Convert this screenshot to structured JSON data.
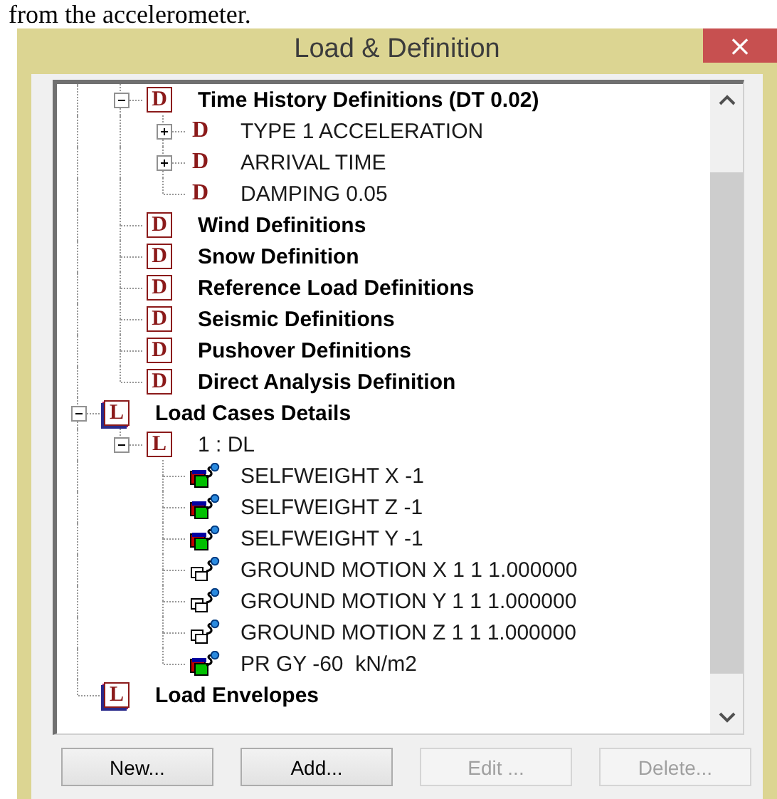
{
  "document_text": "from the accelerometer.",
  "window": {
    "title": "Load & Definition",
    "close": "×"
  },
  "tree": [
    {
      "children": [
        {
          "label": "Time History Definitions (DT 0.02)",
          "kind": "group",
          "icon": {
            "kind": "box",
            "letter": "D"
          },
          "expanded": true,
          "children": [
            {
              "label": "TYPE 1 ACCELERATION",
              "kind": "entry",
              "icon": {
                "kind": "plain",
                "letter": "D"
              },
              "expanded": false
            },
            {
              "label": "ARRIVAL TIME",
              "kind": "entry",
              "icon": {
                "kind": "plain",
                "letter": "D"
              },
              "expanded": false
            },
            {
              "label": "DAMPING 0.05",
              "kind": "entry",
              "icon": {
                "kind": "plain",
                "letter": "D"
              }
            }
          ]
        },
        {
          "label": "Wind Definitions",
          "kind": "group",
          "icon": {
            "kind": "box",
            "letter": "D"
          }
        },
        {
          "label": "Snow Definition",
          "kind": "group",
          "icon": {
            "kind": "box",
            "letter": "D"
          }
        },
        {
          "label": "Reference Load Definitions",
          "kind": "group",
          "icon": {
            "kind": "box",
            "letter": "D"
          }
        },
        {
          "label": "Seismic Definitions",
          "kind": "group",
          "icon": {
            "kind": "box",
            "letter": "D"
          }
        },
        {
          "label": "Pushover Definitions",
          "kind": "group",
          "icon": {
            "kind": "box",
            "letter": "D"
          }
        },
        {
          "label": "Direct Analysis Definition",
          "kind": "group",
          "icon": {
            "kind": "box",
            "letter": "D"
          }
        }
      ]
    },
    {
      "label": "Load Cases Details",
      "kind": "group",
      "icon": {
        "kind": "stack",
        "letter": "L"
      },
      "expanded": true,
      "children": [
        {
          "label": "1 : DL",
          "kind": "entry",
          "icon": {
            "kind": "box",
            "letter": "L"
          },
          "expanded": true,
          "children": [
            {
              "label": "SELFWEIGHT X -1",
              "kind": "entry",
              "icon": {
                "kind": "selfweight"
              }
            },
            {
              "label": "SELFWEIGHT Z -1",
              "kind": "entry",
              "icon": {
                "kind": "selfweight"
              }
            },
            {
              "label": "SELFWEIGHT Y -1",
              "kind": "entry",
              "icon": {
                "kind": "selfweight"
              }
            },
            {
              "label": "GROUND MOTION X 1 1 1.000000",
              "kind": "entry",
              "icon": {
                "kind": "motion"
              }
            },
            {
              "label": "GROUND MOTION Y 1 1 1.000000",
              "kind": "entry",
              "icon": {
                "kind": "motion"
              }
            },
            {
              "label": "GROUND MOTION Z 1 1 1.000000",
              "kind": "entry",
              "icon": {
                "kind": "motion"
              }
            },
            {
              "label": "PR GY -60  kN/m2",
              "kind": "entry",
              "icon": {
                "kind": "selfweight"
              }
            }
          ]
        }
      ]
    },
    {
      "label": "Load Envelopes",
      "kind": "group",
      "icon": {
        "kind": "stack",
        "letter": "L"
      }
    }
  ],
  "buttons": [
    {
      "label": "New...",
      "disabled": false
    },
    {
      "label": "Add...",
      "disabled": false
    },
    {
      "label": "Edit ...",
      "disabled": true
    },
    {
      "label": "Delete...",
      "disabled": true
    }
  ]
}
